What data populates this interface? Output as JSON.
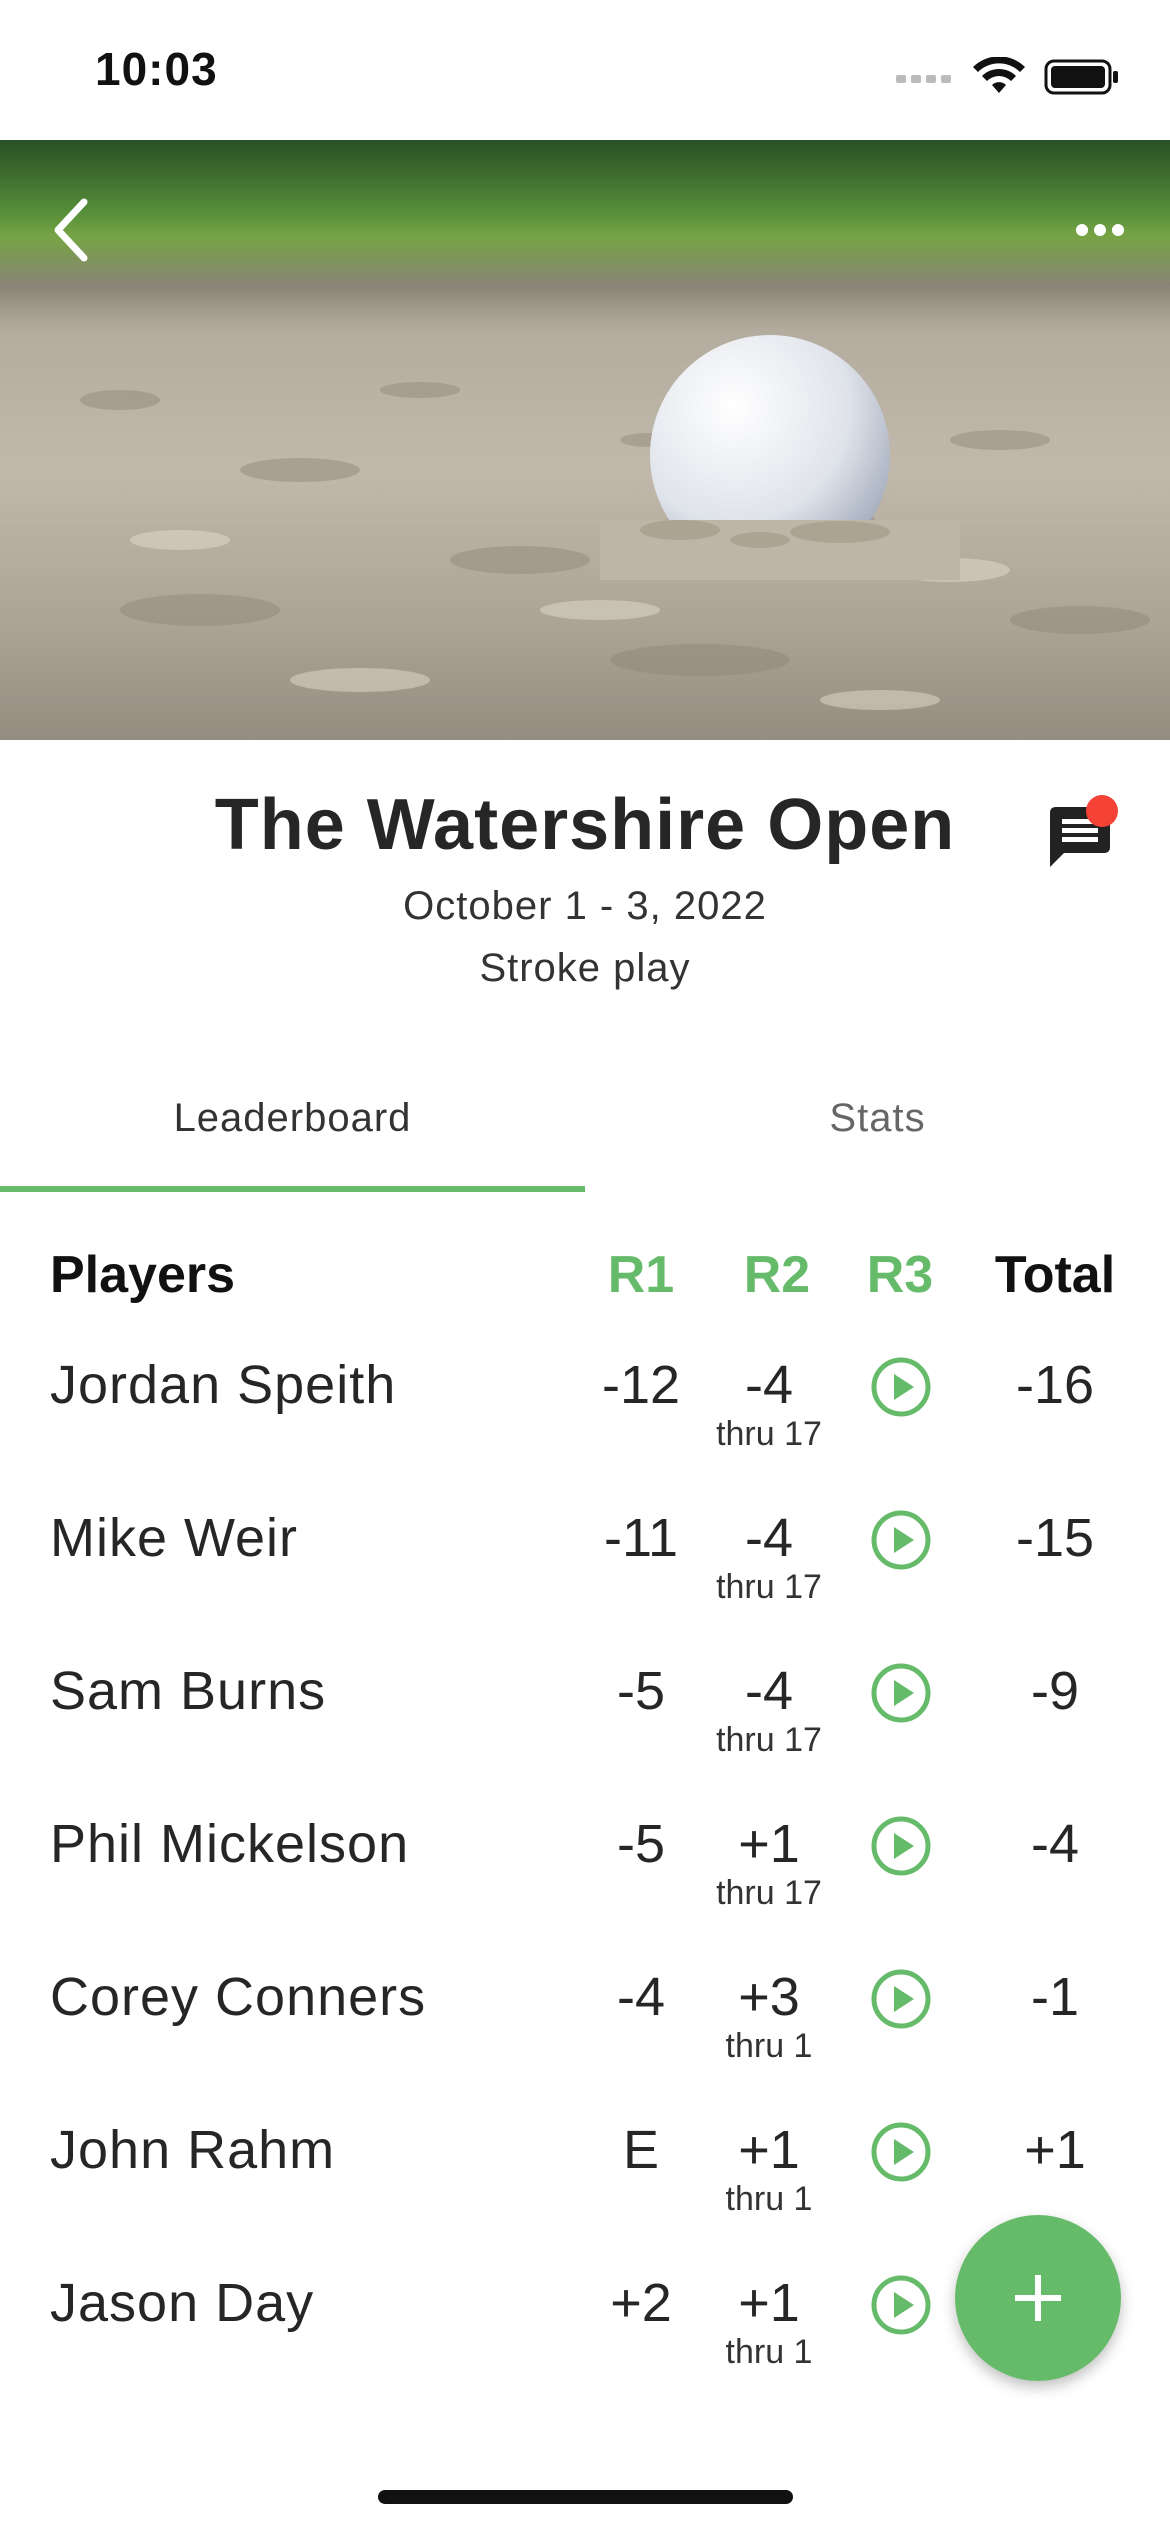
{
  "status_bar": {
    "time": "10:03"
  },
  "tournament": {
    "title": "The Watershire Open",
    "dates": "October 1 - 3, 2022",
    "format": "Stroke play"
  },
  "tabs": [
    {
      "label": "Leaderboard",
      "active": true
    },
    {
      "label": "Stats",
      "active": false
    }
  ],
  "leaderboard": {
    "headers": {
      "players": "Players",
      "r1": "R1",
      "r2": "R2",
      "r3": "R3",
      "total": "Total"
    },
    "rows": [
      {
        "player": "Jordan Speith",
        "r1": "-12",
        "r2": "-4",
        "r2_thru": "thru 17",
        "total": "-16"
      },
      {
        "player": "Mike Weir",
        "r1": "-11",
        "r2": "-4",
        "r2_thru": "thru 17",
        "total": "-15"
      },
      {
        "player": "Sam Burns",
        "r1": "-5",
        "r2": "-4",
        "r2_thru": "thru 17",
        "total": "-9"
      },
      {
        "player": "Phil Mickelson",
        "r1": "-5",
        "r2": "+1",
        "r2_thru": "thru 17",
        "total": "-4"
      },
      {
        "player": "Corey Conners",
        "r1": "-4",
        "r2": "+3",
        "r2_thru": "thru 1",
        "total": "-1"
      },
      {
        "player": "John Rahm",
        "r1": "E",
        "r2": "+1",
        "r2_thru": "thru 1",
        "total": "+1"
      },
      {
        "player": "Jason Day",
        "r1": "+2",
        "r2": "+1",
        "r2_thru": "thru 1",
        "total": ""
      }
    ]
  },
  "icons": {
    "back": "chevron-left-icon",
    "more": "more-horizontal-icon",
    "chat": "chat-icon",
    "play": "play-circle-icon",
    "fab": "plus-icon"
  },
  "colors": {
    "accent": "#66bb6a",
    "notification": "#f44336",
    "text": "#262626"
  }
}
